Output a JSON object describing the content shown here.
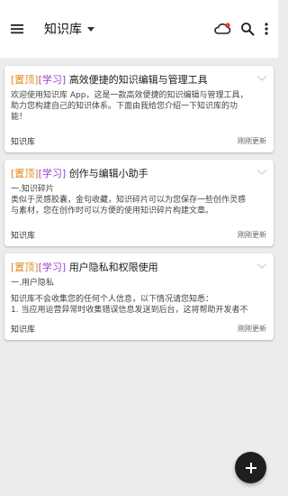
{
  "appbar": {
    "title": "知识库",
    "icons": [
      "menu-icon",
      "cloud-sync-icon",
      "search-icon",
      "more-vert-icon"
    ]
  },
  "cards": [
    {
      "tag_top": "[置顶]",
      "tag_study": "[学习]",
      "title": "高效便捷的知识编辑与管理工具",
      "body_lines": [
        "欢迎使用知识库 App，这是一款高效便捷的知识编辑与管理工具，",
        "助力您构建自己的知识体系。下面由我给您介绍一下知识库的功",
        "能！"
      ],
      "kb_name": "知识库",
      "updated": "刚刚更新"
    },
    {
      "tag_top": "[置顶]",
      "tag_study": "[学习]",
      "title": "创作与编辑小助手",
      "body_lines": [
        "一.知识碎片",
        "类似于灵感胶囊，金句收藏，知识碎片可以为您保存一些创作灵感",
        "与素材，您在创作时可以方便的使用知识碎片构建文章。"
      ],
      "kb_name": "知识库",
      "updated": "刚刚更新"
    },
    {
      "tag_top": "[置顶]",
      "tag_study": "[学习]",
      "title": "用户隐私和权限使用",
      "body_lines": [
        "一.用户隐私",
        "",
        "知识库不会收集您的任何个人信息，以下情况请您知悉：",
        "1. 当应用运营异常时收集错误信息发送到后台，这将帮助开发者不"
      ],
      "kb_name": "知识库",
      "updated": "刚刚更新"
    }
  ],
  "colors": {
    "tag_top": "#e08a1e",
    "tag_study": "#9b3fd1",
    "fab": "#1f1f1f",
    "background": "#ececec"
  },
  "fab": {
    "icon": "plus-icon"
  }
}
